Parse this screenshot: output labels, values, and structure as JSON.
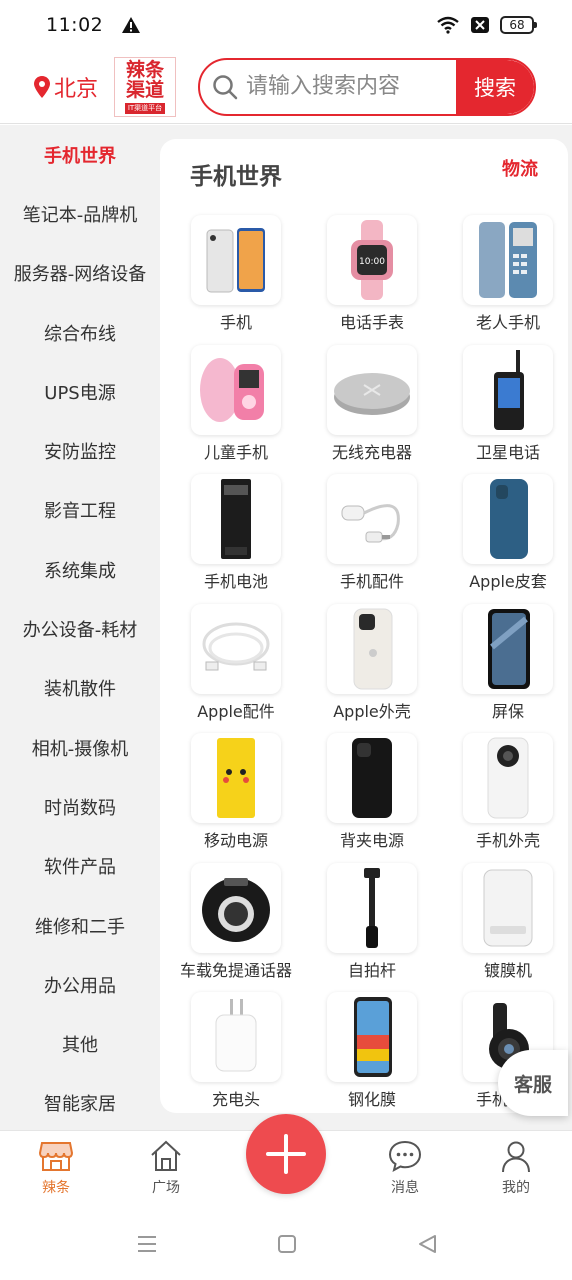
{
  "status": {
    "time": "11:02",
    "battery": "68"
  },
  "header": {
    "city": "北京",
    "logo_text": "辣条渠道",
    "logo_sub": "IT渠道平台",
    "search_placeholder": "请输入搜索内容",
    "search_button": "搜索"
  },
  "sidebar": {
    "items": [
      {
        "label": "手机世界"
      },
      {
        "label": "笔记本-品牌机"
      },
      {
        "label": "服务器-网络设备"
      },
      {
        "label": "综合布线"
      },
      {
        "label": "UPS电源"
      },
      {
        "label": "安防监控"
      },
      {
        "label": "影音工程"
      },
      {
        "label": "系统集成"
      },
      {
        "label": "办公设备-耗材"
      },
      {
        "label": "装机散件"
      },
      {
        "label": "相机-摄像机"
      },
      {
        "label": "时尚数码"
      },
      {
        "label": "软件产品"
      },
      {
        "label": "维修和二手"
      },
      {
        "label": "办公用品"
      },
      {
        "label": "其他"
      },
      {
        "label": "智能家居"
      }
    ]
  },
  "panel": {
    "title": "手机世界",
    "link": "物流",
    "items": [
      {
        "label": "手机",
        "icon": "smartphone"
      },
      {
        "label": "电话手表",
        "icon": "kids-watch"
      },
      {
        "label": "老人手机",
        "icon": "feature-phone"
      },
      {
        "label": "儿童手机",
        "icon": "kids-phone"
      },
      {
        "label": "无线充电器",
        "icon": "wireless-charger"
      },
      {
        "label": "卫星电话",
        "icon": "satellite-phone"
      },
      {
        "label": "手机电池",
        "icon": "battery"
      },
      {
        "label": "手机配件",
        "icon": "adapter"
      },
      {
        "label": "Apple皮套",
        "icon": "leather-case"
      },
      {
        "label": "Apple配件",
        "icon": "cable"
      },
      {
        "label": "Apple外壳",
        "icon": "phone-case"
      },
      {
        "label": "屏保",
        "icon": "screen-protector"
      },
      {
        "label": "移动电源",
        "icon": "power-bank"
      },
      {
        "label": "背夹电源",
        "icon": "battery-case"
      },
      {
        "label": "手机外壳",
        "icon": "white-case"
      },
      {
        "label": "车载免提通话器",
        "icon": "car-speakerphone"
      },
      {
        "label": "自拍杆",
        "icon": "selfie-stick"
      },
      {
        "label": "镀膜机",
        "icon": "coating-machine"
      },
      {
        "label": "充电头",
        "icon": "charger-head"
      },
      {
        "label": "钢化膜",
        "icon": "tempered-glass"
      },
      {
        "label": "手机镜头",
        "icon": "phone-lens"
      }
    ]
  },
  "floating": {
    "kefu": "客服"
  },
  "bottom_nav": {
    "home": "辣条",
    "square": "广场",
    "messages": "消息",
    "mine": "我的"
  },
  "colors": {
    "accent": "#e4272f",
    "nav_active": "#e4762f",
    "fab": "#ee4b4f"
  }
}
